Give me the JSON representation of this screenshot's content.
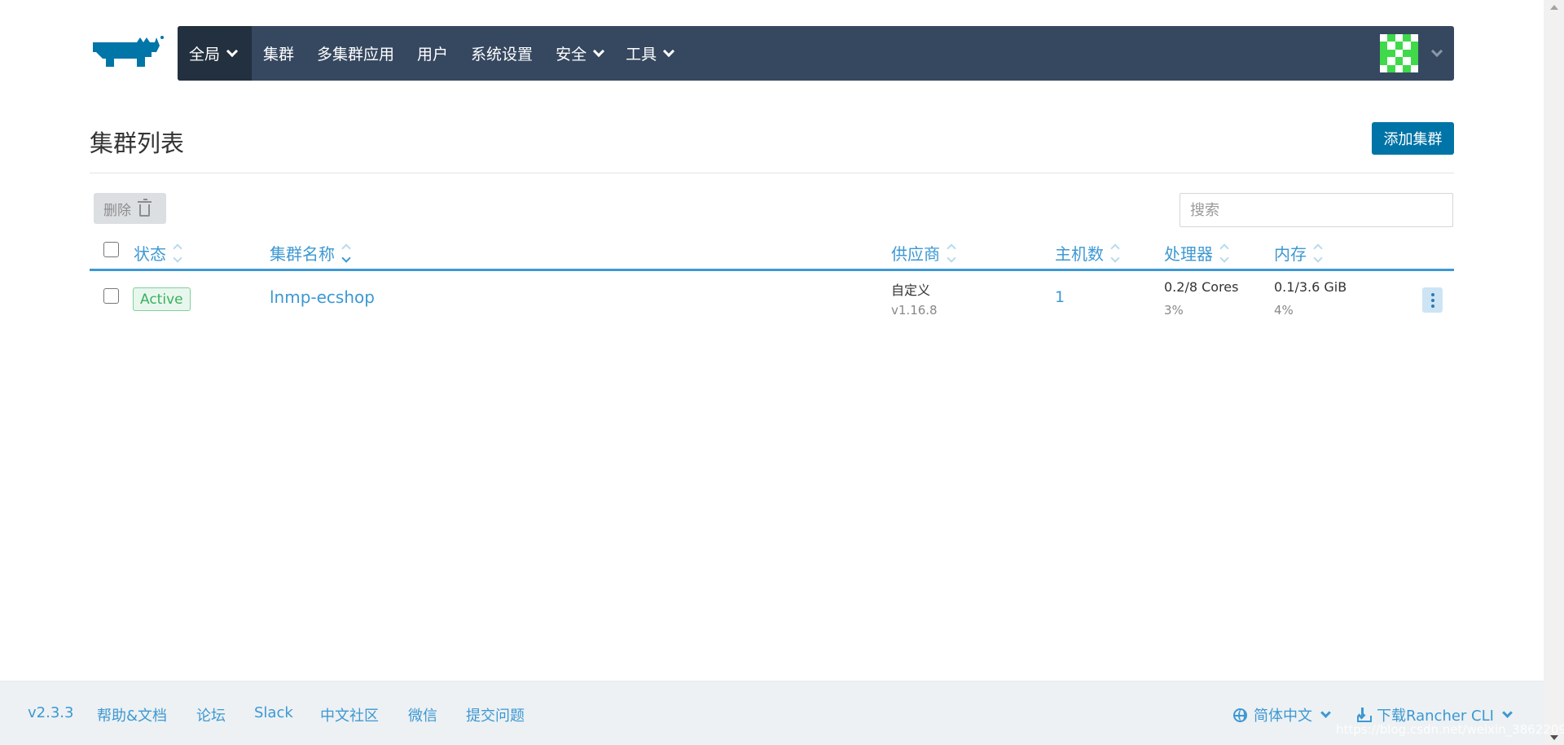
{
  "nav": {
    "items": [
      {
        "label": "全局",
        "dropdown": true,
        "active": true
      },
      {
        "label": "集群",
        "dropdown": false
      },
      {
        "label": "多集群应用",
        "dropdown": false
      },
      {
        "label": "用户",
        "dropdown": false
      },
      {
        "label": "系统设置",
        "dropdown": false
      },
      {
        "label": "安全",
        "dropdown": true
      },
      {
        "label": "工具",
        "dropdown": true
      }
    ]
  },
  "page": {
    "title": "集群列表",
    "add_button": "添加集群",
    "delete_button": "删除",
    "search_placeholder": "搜索"
  },
  "table": {
    "headers": {
      "state": "状态",
      "name": "集群名称",
      "provider": "供应商",
      "nodes": "主机数",
      "cpu": "处理器",
      "memory": "内存"
    },
    "rows": [
      {
        "state": "Active",
        "name": "lnmp-ecshop",
        "provider": "自定义",
        "version": "v1.16.8",
        "nodes": "1",
        "cpu": "0.2/8 Cores",
        "cpu_pct": "3%",
        "memory": "0.1/3.6 GiB",
        "memory_pct": "4%"
      }
    ]
  },
  "footer": {
    "version": "v2.3.3",
    "links": [
      "帮助&文档",
      "论坛",
      "Slack",
      "中文社区",
      "微信",
      "提交问题"
    ],
    "language": "简体中文",
    "download_cli": "下载Rancher CLI",
    "watermark": "https://blog.csdn.net/weixin_38622094"
  },
  "colors": {
    "header_bg": "#364860",
    "accent": "#3d98d3",
    "primary_button": "#0074a6",
    "active_badge": "#3bb05e"
  }
}
